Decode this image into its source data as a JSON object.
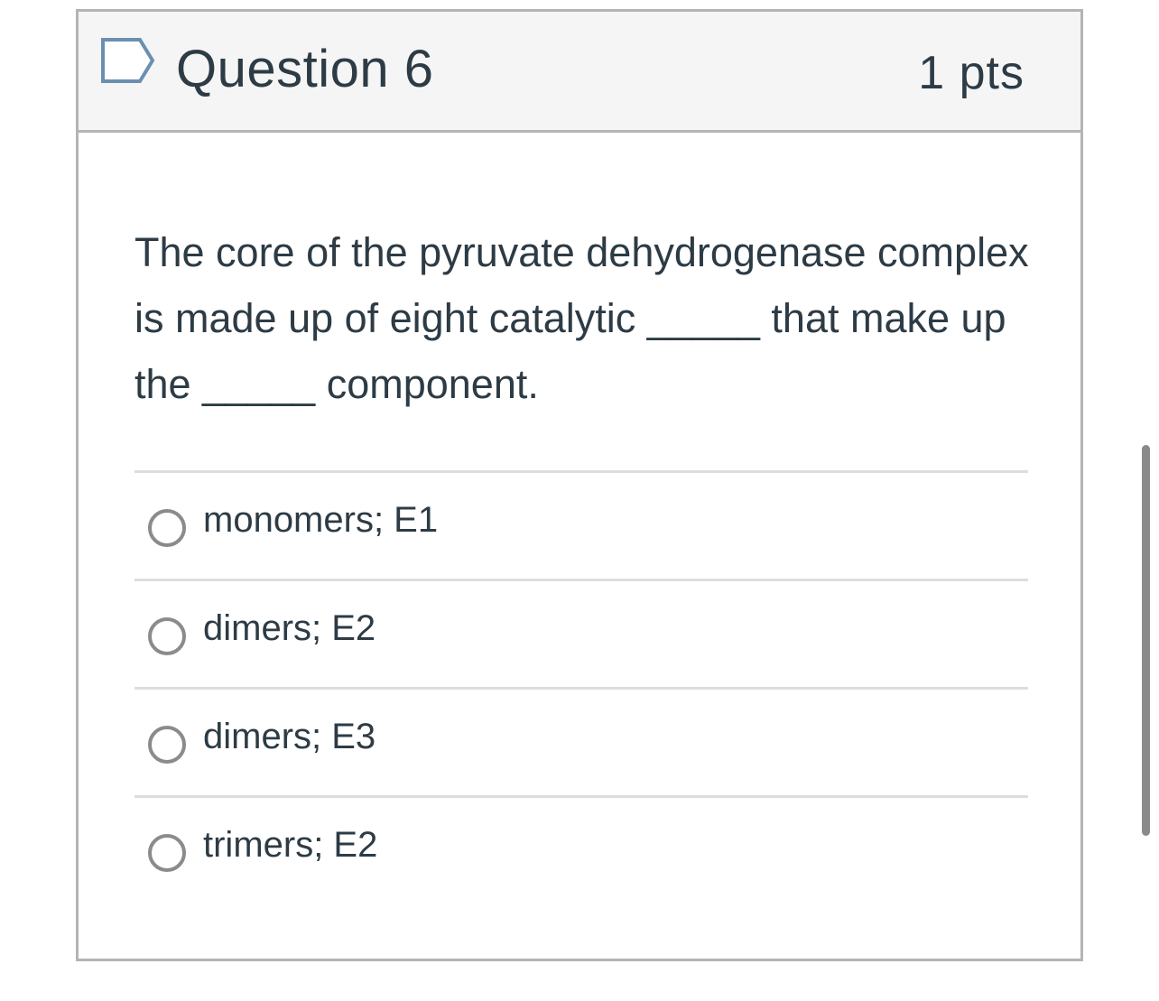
{
  "question": {
    "title": "Question 6",
    "points": "1 pts",
    "flag_icon": "flag-outline-icon",
    "text": "The core of the pyruvate dehydrogenase complex is made up of eight catalytic _____ that make up the _____ component."
  },
  "answers": [
    {
      "label": "monomers; E1",
      "selected": false
    },
    {
      "label": "dimers; E2",
      "selected": false
    },
    {
      "label": "dimers; E3",
      "selected": false
    },
    {
      "label": "trimers; E2",
      "selected": false
    }
  ],
  "colors": {
    "header_bg": "#f5f5f5",
    "border": "#b4b4b4",
    "text": "#2d3b45",
    "flag": "#6b8fb0"
  }
}
